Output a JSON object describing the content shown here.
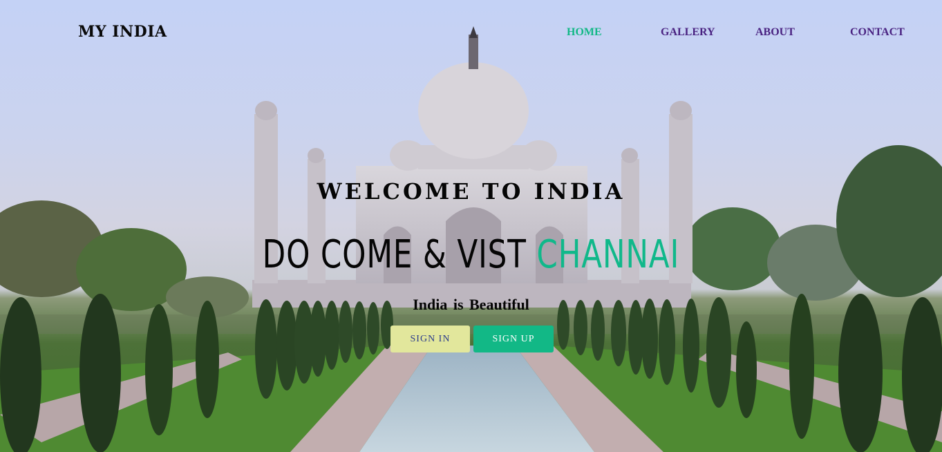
{
  "brand": {
    "name": "MY INDIA"
  },
  "nav": {
    "home": "HOME",
    "gallery": "GALLERY",
    "about": "ABOUT",
    "contact": "CONTACT"
  },
  "hero": {
    "welcome": "WELCOME TO INDIA",
    "tagline_main": "DO COME & VIST ",
    "tagline_accent": "CHANNAI",
    "subtitle": "India is Beautiful",
    "signin_label": "SIGN IN",
    "signup_label": "SIGN UP"
  },
  "colors": {
    "accent": "#12b886",
    "nav_link": "#4a2382",
    "signin_bg": "#e2e79c"
  }
}
